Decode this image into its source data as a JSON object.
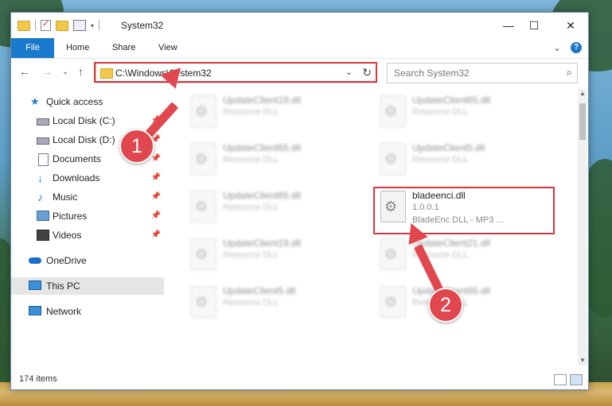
{
  "window": {
    "title": "System32"
  },
  "titlebar": {
    "minimize_glyph": "—",
    "maximize_glyph": "☐",
    "close_glyph": "✕"
  },
  "ribbon": {
    "tabs": [
      {
        "label": "File"
      },
      {
        "label": "Home"
      },
      {
        "label": "Share"
      },
      {
        "label": "View"
      }
    ],
    "expand_glyph": "⌄",
    "help_glyph": "?"
  },
  "nav": {
    "back_glyph": "←",
    "forward_glyph": "→",
    "recent_glyph": "⌄",
    "up_glyph": "↑"
  },
  "address": {
    "path": "C:\\Windows\\System32",
    "dropdown_glyph": "⌄",
    "refresh_glyph": "↻"
  },
  "search": {
    "placeholder": "Search System32",
    "icon_glyph": "⌕"
  },
  "sidebar": {
    "items": [
      {
        "label": "Quick access",
        "icon": "star-icon"
      },
      {
        "label": "Local Disk (C:)",
        "icon": "drive-icon",
        "pinned": true
      },
      {
        "label": "Local Disk (D:)",
        "icon": "drive-icon",
        "pinned": true
      },
      {
        "label": "Documents",
        "icon": "document-icon",
        "pinned": true
      },
      {
        "label": "Downloads",
        "icon": "download-icon",
        "pinned": true
      },
      {
        "label": "Music",
        "icon": "music-icon",
        "pinned": true
      },
      {
        "label": "Pictures",
        "icon": "picture-icon",
        "pinned": true
      },
      {
        "label": "Videos",
        "icon": "video-icon",
        "pinned": true
      },
      {
        "label": "OneDrive",
        "icon": "cloud-icon"
      },
      {
        "label": "This PC",
        "icon": "computer-icon",
        "selected": true
      },
      {
        "label": "Network",
        "icon": "network-icon"
      }
    ],
    "pin_glyph": "📌"
  },
  "files": [
    {
      "name": "UpdateClient19.dll",
      "desc": "Resource DLL",
      "blurred": true
    },
    {
      "name": "UpdateClient65.dll",
      "desc": "Resource DLL",
      "blurred": true
    },
    {
      "name": "UpdateClient65.dll",
      "desc": "Resource DLL",
      "blurred": true
    },
    {
      "name": "UpdateClient5.dll",
      "desc": "Resource DLL",
      "blurred": true
    },
    {
      "name": "UpdateClient65.dll",
      "desc": "Resource DLL",
      "blurred": true
    },
    {
      "name": "bladeenci.dll",
      "desc": "1.0.0.1",
      "desc2": "BladeEnc DLL - MP3 ...",
      "blurred": false
    },
    {
      "name": "UpdateClient19.dll",
      "desc": "Resource DLL",
      "blurred": true
    },
    {
      "name": "UpdateClient21.dll",
      "desc": "Resource DLL",
      "blurred": true
    },
    {
      "name": "UpdateClient5.dll",
      "desc": "Resource DLL",
      "blurred": true
    },
    {
      "name": "UpdateClient65.dll",
      "desc": "Resource DLL",
      "blurred": true
    }
  ],
  "status": {
    "item_count": "174 items"
  },
  "annotations": {
    "step1": "1",
    "step2": "2",
    "highlight_color": "#d9363e"
  },
  "colors": {
    "accent": "#1979ca",
    "selection": "#e5e5e5"
  }
}
